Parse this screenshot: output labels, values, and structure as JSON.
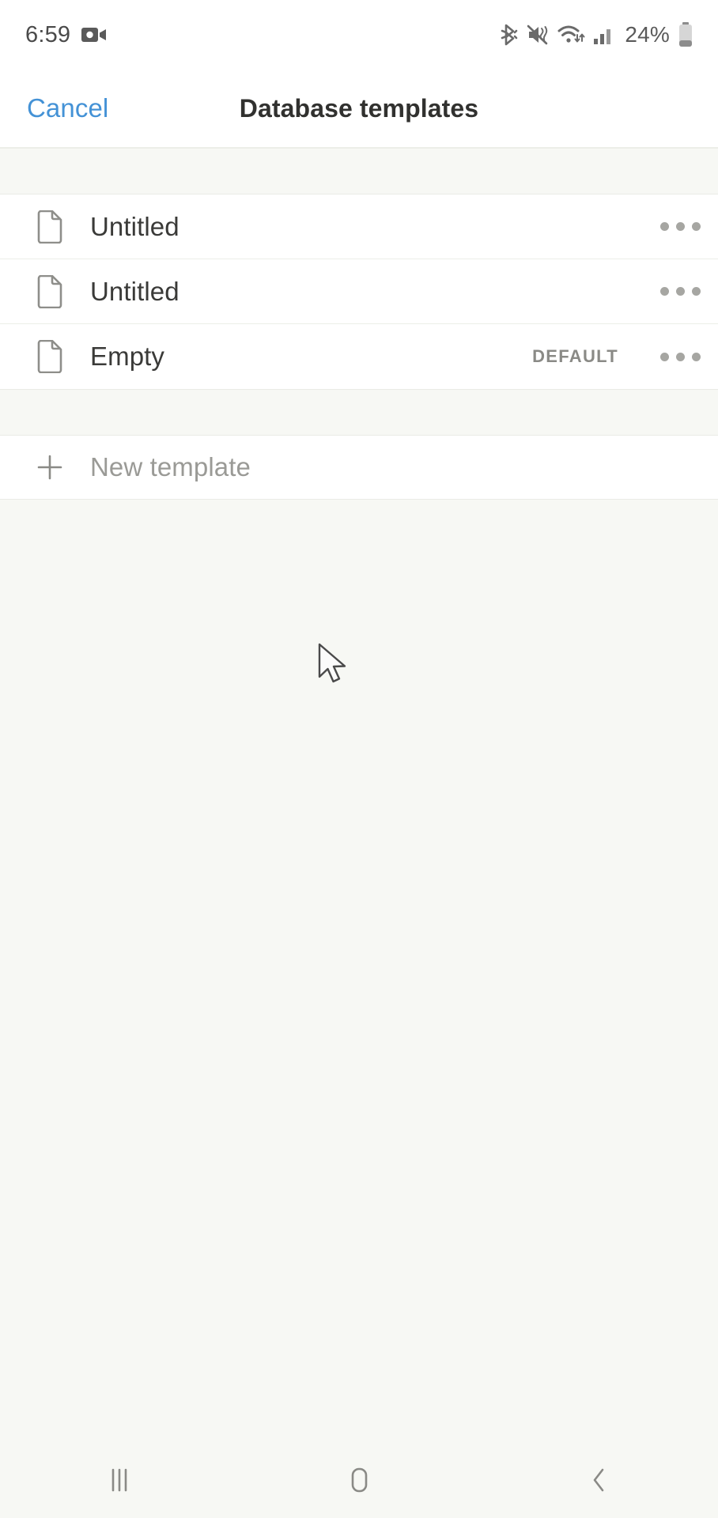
{
  "status_bar": {
    "time": "6:59",
    "battery_percent": "24%",
    "icons": [
      "screen-record-icon",
      "bluetooth-icon",
      "volume-mute-icon",
      "wifi-icon",
      "cellular-signal-icon",
      "battery-icon"
    ]
  },
  "header": {
    "cancel_label": "Cancel",
    "title": "Database templates"
  },
  "templates": [
    {
      "label": "Untitled",
      "badge": "",
      "icon": "document-icon",
      "more": "more-options-icon"
    },
    {
      "label": "Untitled",
      "badge": "",
      "icon": "document-icon",
      "more": "more-options-icon"
    },
    {
      "label": "Empty",
      "badge": "DEFAULT",
      "icon": "document-icon",
      "more": "more-options-icon"
    }
  ],
  "new_template": {
    "label": "New template",
    "icon": "plus-icon"
  },
  "nav_bar": {
    "recents_label": "recents-icon",
    "home_label": "home-icon",
    "back_label": "back-icon"
  },
  "colors": {
    "accent_blue": "#4492d6",
    "page_background": "#f7f8f4",
    "row_background": "#ffffff",
    "title_text": "#31312f",
    "muted_text": "#9a9a96"
  }
}
